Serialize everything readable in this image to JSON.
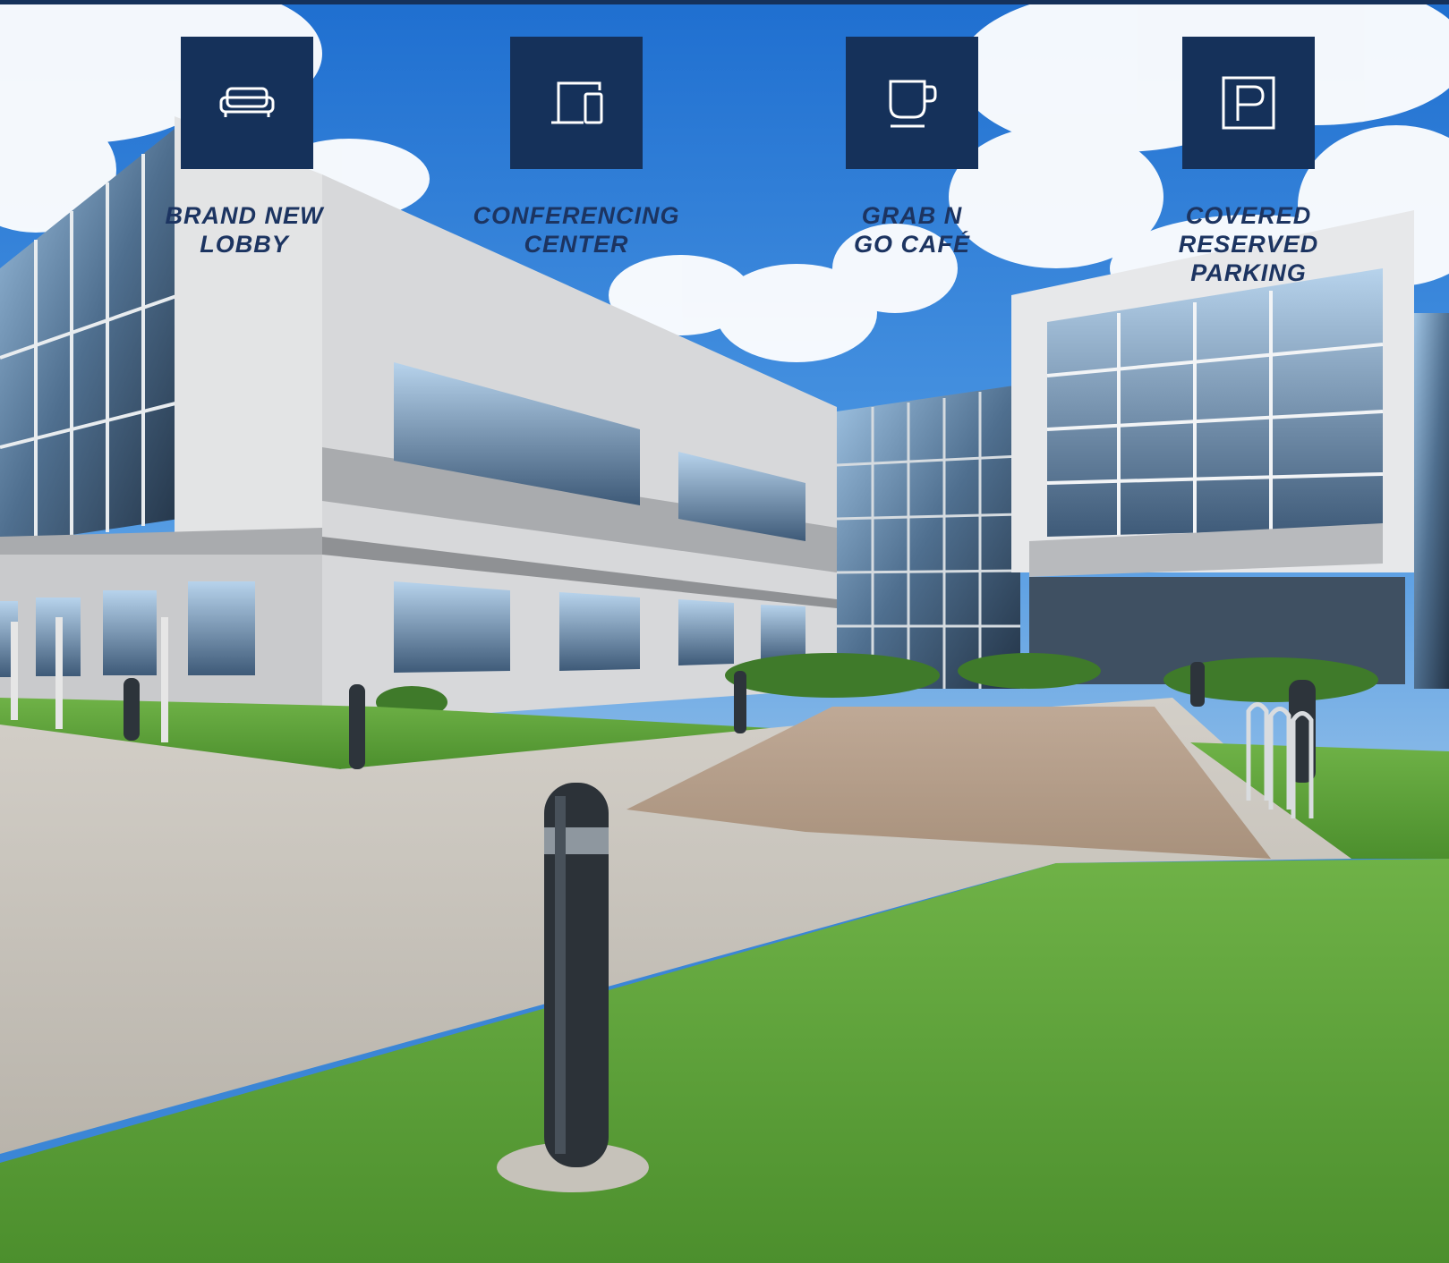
{
  "colors": {
    "brand_navy": "#15315a",
    "label_navy": "#1c3461",
    "sky_blue": "#3b86d6",
    "grass_green": "#5aa23a",
    "concrete": "#c9c4bb"
  },
  "amenities": [
    {
      "icon": "sofa-icon",
      "lines": [
        "BRAND NEW",
        "LOBBY"
      ]
    },
    {
      "icon": "devices-icon",
      "lines": [
        "CONFERENCING",
        "CENTER"
      ]
    },
    {
      "icon": "coffee-cup-icon",
      "lines": [
        "GRAB N",
        "GO CAFÉ"
      ]
    },
    {
      "icon": "parking-icon",
      "lines": [
        "COVERED",
        "RESERVED",
        "PARKING"
      ]
    }
  ]
}
